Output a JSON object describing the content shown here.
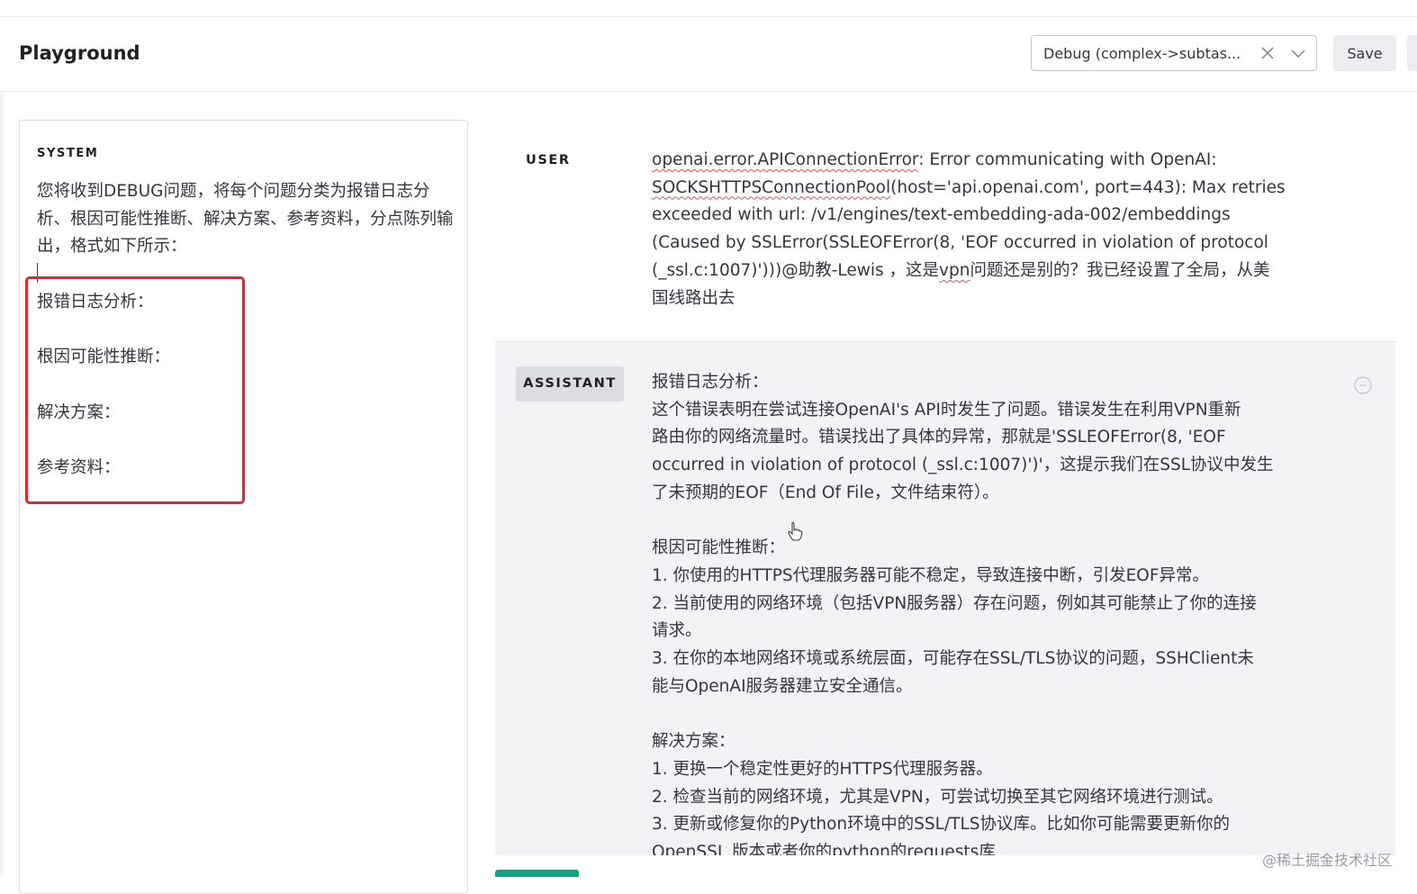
{
  "header": {
    "title": "Playground",
    "preset": {
      "selected": "Debug (complex->subtas...",
      "clear_icon": "close-icon",
      "expand_icon": "chevron-down-icon"
    },
    "save_label": "Save"
  },
  "system": {
    "label": "SYSTEM",
    "text": "您将收到DEBUG问题，将每个问题分类为报错日志分析、根因可能性推断、解决方案、参考资料，分点陈列输出，格式如下所示：",
    "items": [
      "报错日志分析：",
      "根因可能性推断：",
      "解决方案：",
      "参考资料："
    ]
  },
  "messages": {
    "user": {
      "role": "USER",
      "segments": [
        "openai.error.APIConnectionError",
        ": Error communicating with OpenAI:\n",
        "SOCKSHTTPSConnectionPool",
        "(host='api.openai.com', port=443): Max retries\nexceeded with url: /v1/engines/text-embedding-ada-002/embeddings\n(Caused by SSLError(SSLEOFError(8, 'EOF occurred in violation of protocol\n(_ssl.c:1007)')))@助教-Lewis ，这是",
        "vpn",
        "问题还是别的？我已经设置了全局，从美\n国线路出去"
      ]
    },
    "assistant": {
      "role": "ASSISTANT",
      "text": "报错日志分析：\n这个错误表明在尝试连接OpenAI's API时发生了问题。错误发生在利用VPN重新\n路由你的网络流量时。错误找出了具体的异常，那就是'SSLEOFError(8, 'EOF\noccurred in violation of protocol (_ssl.c:1007)')'，这提示我们在SSL协议中发生\n了未预期的EOF（End Of File，文件结束符）。\n\n根因可能性推断：\n1. 你使用的HTTPS代理服务器可能不稳定，导致连接中断，引发EOF异常。\n2. 当前使用的网络环境（包括VPN服务器）存在问题，例如其可能禁止了你的连接\n请求。\n3. 在你的本地网络环境或系统层面，可能存在SSL/TLS协议的问题，SSHClient未\n能与OpenAI服务器建立安全通信。\n\n解决方案：\n1. 更换一个稳定性更好的HTTPS代理服务器。\n2. 检查当前的网络环境，尤其是VPN，可尝试切换至其它网络环境进行测试。\n3. 更新或修复你的Python环境中的SSL/TLS协议库。比如你可能需要更新你的\nOpenSSL 版本或者你的python的requests库",
      "remove_icon": "minus-circle-icon"
    }
  },
  "watermark": "@稀土掘金技术社区",
  "colors": {
    "highlight_border": "#e8242a",
    "submit_green": "#10a37f",
    "assistant_bg": "#f3f3f6"
  }
}
